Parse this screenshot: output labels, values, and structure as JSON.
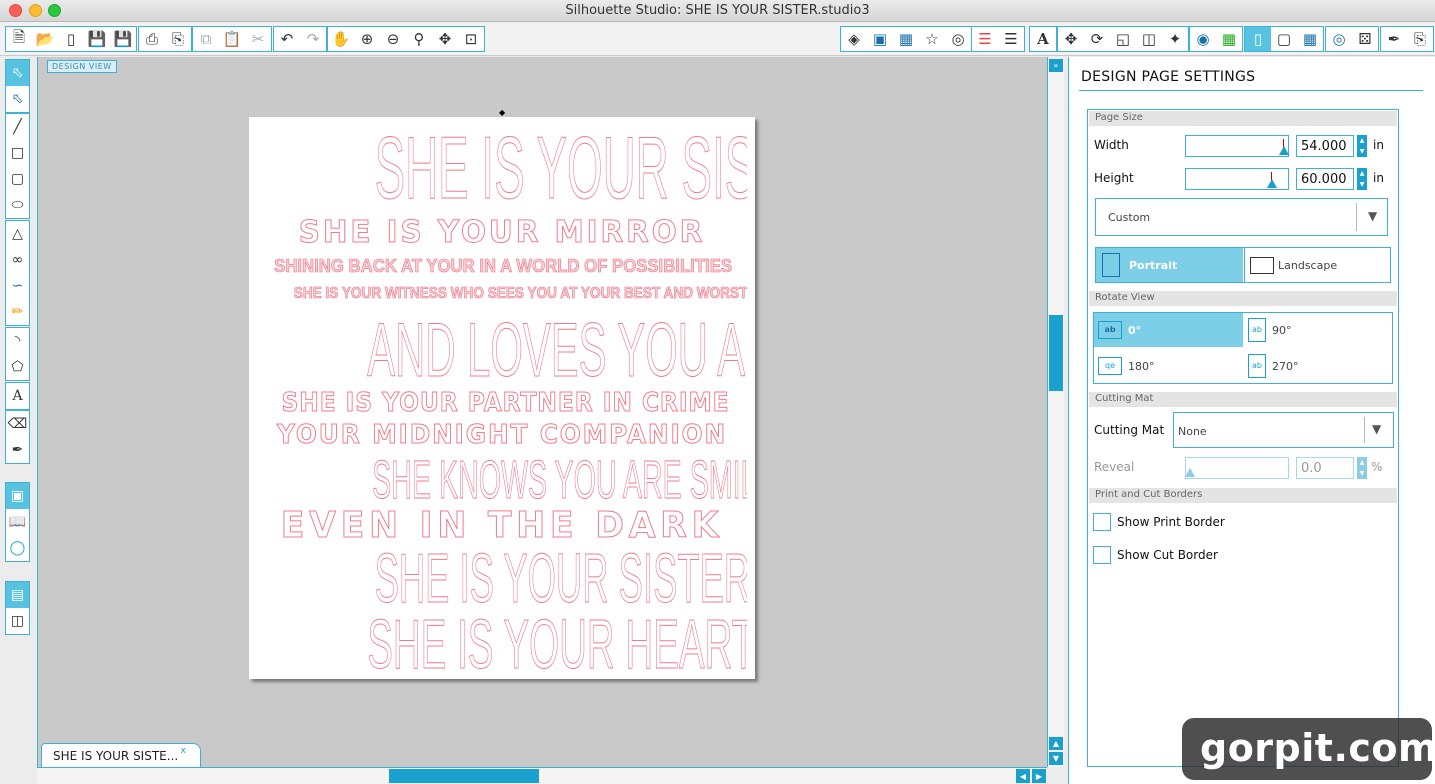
{
  "window": {
    "title": "Silhouette Studio: SHE IS YOUR SISTER.studio3"
  },
  "canvas": {
    "view_label": "DESIGN VIEW"
  },
  "page_text": [
    "SHE IS YOUR SISTER",
    "SHE IS YOUR MIRROR",
    "SHINING BACK AT YOUR IN A WORLD OF POSSIBILITIES",
    "SHE IS YOUR WITNESS WHO SEES YOU AT YOUR BEST AND WORST",
    "AND LOVES YOU ANYWAY",
    "SHE IS YOUR PARTNER IN CRIME",
    "YOUR MIDNIGHT COMPANION",
    "SHE KNOWS YOU ARE SMILING",
    "EVEN IN THE DARK",
    "SHE IS YOUR SISTER",
    "SHE IS YOUR HEART"
  ],
  "doc_tab": {
    "label": "SHE IS YOUR SISTE...",
    "close": "x"
  },
  "panel": {
    "title": "DESIGN PAGE SETTINGS",
    "page_size": {
      "header": "Page Size",
      "width_label": "Width",
      "width_value": "54.000",
      "height_label": "Height",
      "height_value": "60.000",
      "unit": "in",
      "preset": "Custom",
      "portrait": "Portrait",
      "landscape": "Landscape"
    },
    "rotate_view": {
      "header": "Rotate View",
      "r0": "0°",
      "r90": "90°",
      "r180": "180°",
      "r270": "270°"
    },
    "cutting_mat": {
      "header": "Cutting Mat",
      "label": "Cutting Mat",
      "value": "None",
      "reveal_label": "Reveal",
      "reveal_value": "0.0",
      "reveal_unit": "%"
    },
    "borders": {
      "header": "Print and Cut Borders",
      "show_print": "Show Print Border",
      "show_cut": "Show Cut Border"
    }
  },
  "watermark": "gorpit.com"
}
